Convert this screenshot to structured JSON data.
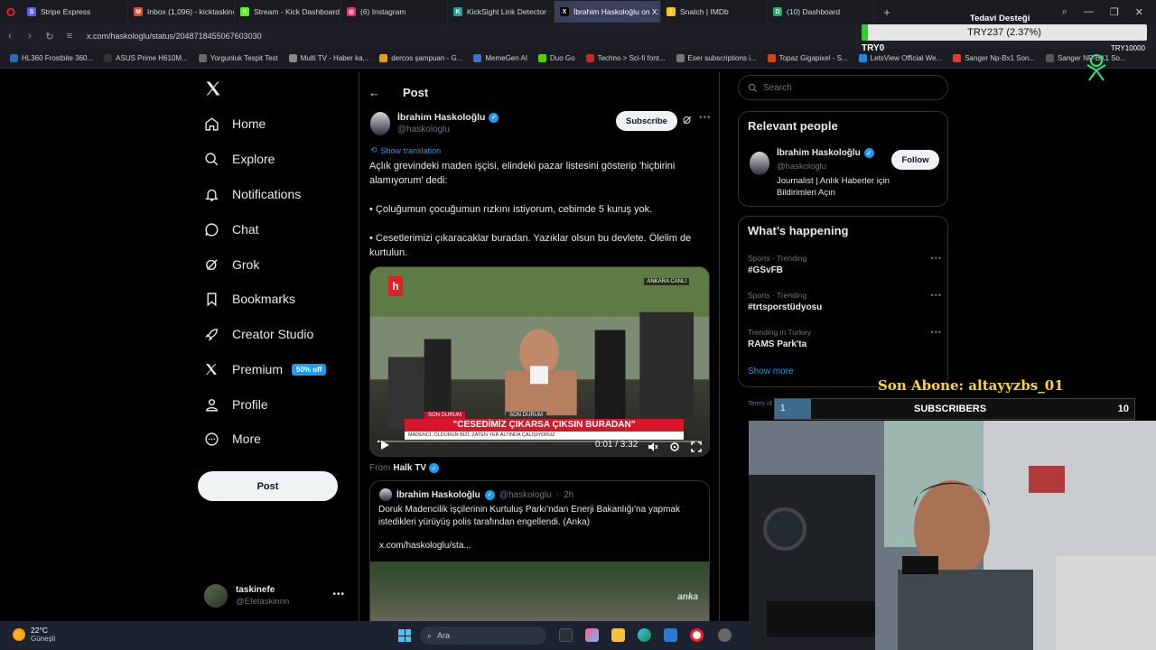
{
  "browser": {
    "tabs": [
      {
        "label": "Stripe Express",
        "color": "#635bff",
        "glyph": "S"
      },
      {
        "label": "Inbox (1,096) - kicktaskinc",
        "color": "#ea4335",
        "glyph": "M"
      },
      {
        "label": "Stream - Kick Dashboard",
        "color": "#53fc18",
        "glyph": "K"
      },
      {
        "label": "(6) Instagram",
        "color": "#e1306c",
        "glyph": "◎"
      },
      {
        "label": "KickSight Link Detector",
        "color": "#2a9d8f",
        "glyph": "K"
      },
      {
        "label": "İbrahim Haskoloğlu on X:",
        "color": "#000000",
        "glyph": "X"
      },
      {
        "label": "Snatch | IMDb",
        "color": "#f5c518",
        "glyph": "i"
      },
      {
        "label": "(10) Dashboard",
        "color": "#22aa66",
        "glyph": "D"
      }
    ],
    "url": "x.com/haskologlu/status/2048718455067603030",
    "bookmarks": [
      "HL360 Frostbite 360...",
      "ASUS Prime H610M...",
      "Yorgunluk Tespit Test",
      "Multi TV - Haber ka...",
      "dercos şampuan - G...",
      "MemeGen AI",
      "Duo Go",
      "Techno > Sci-fi font...",
      "Eser subscriptions i...",
      "Topaz Gigapixel - S...",
      "LetsView Official We...",
      "Sanger Np-Bx1 Son...",
      "Sanger NP-BX1 So..."
    ]
  },
  "donation": {
    "title": "Tedavi Desteği",
    "value_text": "TRY237 (2.37%)",
    "progress_pct": 2.37,
    "min": "TRY0",
    "max": "TRY10000",
    "fill_color": "#37c837"
  },
  "nav": {
    "items": [
      {
        "label": "Home",
        "icon": "home-icon"
      },
      {
        "label": "Explore",
        "icon": "search-icon"
      },
      {
        "label": "Notifications",
        "icon": "bell-icon"
      },
      {
        "label": "Chat",
        "icon": "chat-icon"
      },
      {
        "label": "Grok",
        "icon": "grok-icon"
      },
      {
        "label": "Bookmarks",
        "icon": "bookmark-icon"
      },
      {
        "label": "Creator Studio",
        "icon": "rocket-icon"
      },
      {
        "label": "Premium",
        "icon": "x-icon"
      },
      {
        "label": "Profile",
        "icon": "person-icon"
      },
      {
        "label": "More",
        "icon": "more-circle-icon"
      }
    ],
    "premium_badge": "50% off",
    "post_button": "Post",
    "account": {
      "name": "taskinefe",
      "handle": "@Efetaskinnn"
    }
  },
  "post": {
    "header_title": "Post",
    "author_name": "İbrahim Haskoloğlu",
    "author_handle": "@haskologlu",
    "subscribe_label": "Subscribe",
    "show_translation": "Show translation",
    "paragraphs": [
      "Açlık grevindeki maden işçisi, elindeki pazar listesini gösterip 'hiçbirini alamıyorum' dedi:",
      "• Çoluğumun çocuğumun rızkını istiyorum, cebimde 5 kuruş yok.",
      "• Cesetlerimizi çıkaracaklar buradan. Yazıklar olsun bu devlete. Ölelim de kurtulun."
    ],
    "video": {
      "canli": "ANKARA CANLI",
      "top_tag_1": "SON DURUM",
      "top_tag_2": "SON DURUM",
      "headline": "\"CESEDİMİZ ÇIKARSA ÇIKSIN BURADAN\"",
      "subline": "MADENCİ: ÖLDÜRÜN BİZİ, ZATEN YER ALTINDA ÇALIŞIYORUZ",
      "time": "0:01 / 3:32",
      "progress_fraction": 0.005
    },
    "from_label": "From",
    "from_source": "Halk TV",
    "quote": {
      "name": "İbrahim Haskoloğlu",
      "handle": "@haskologlu",
      "age": "2h",
      "text": "Doruk Madencilik işçilerinin Kurtuluş Parkı'ndan Enerji Bakanlığı'na yapmak istedikleri yürüyüş polis tarafından engellendi. (Anka)",
      "link": "x.com/haskologlu/sta...",
      "watermark": "anka"
    }
  },
  "sidebar": {
    "search_placeholder": "Search",
    "relevant_title": "Relevant people",
    "person": {
      "name": "İbrahim Haskoloğlu",
      "handle": "@haskologlu",
      "bio": "Journalist | Anlık Haberler için Bildirimleri Açın",
      "follow_label": "Follow"
    },
    "happening_title": "What’s happening",
    "trends": [
      {
        "meta": "Sports · Trending",
        "name": "#GSvFB"
      },
      {
        "meta": "Sports · Trending",
        "name": "#trtsporstüdyosu"
      },
      {
        "meta": "Trending in Turkey",
        "name": "RAMS Park'ta"
      }
    ],
    "show_more": "Show more",
    "footer": "Terms of Service  |  Privacy Policy  |  Cookie Policy"
  },
  "stream": {
    "son_abone": "Son Abone: altayyzbs_01",
    "subs_title": "SUBSCRIBERS",
    "subs_current": "1",
    "subs_goal": "10",
    "subs_progress_fraction": 0.1
  },
  "taskbar": {
    "temp": "22°C",
    "condition": "Güneşli",
    "search_placeholder": "Ara"
  }
}
